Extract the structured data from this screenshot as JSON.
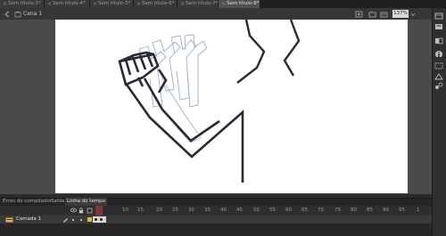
{
  "document_tabs": [
    {
      "label": "Sem título-3*",
      "active": false
    },
    {
      "label": "Sem título-4*",
      "active": false
    },
    {
      "label": "Sem título-5*",
      "active": false
    },
    {
      "label": "Sem título-6*",
      "active": false
    },
    {
      "label": "Sem título-7*",
      "active": false
    },
    {
      "label": "Sem título-8*",
      "active": true
    }
  ],
  "edit_bar": {
    "scene": "Cena 1",
    "zoom": "137%"
  },
  "panel_tabs": [
    "Erros do compilador",
    "Saída",
    "Linha do tempo"
  ],
  "timeline": {
    "frame_numbers": [
      "10",
      "15",
      "20",
      "25",
      "30",
      "35",
      "40",
      "45",
      "50",
      "55",
      "60",
      "65",
      "70",
      "75",
      "80",
      "85",
      "90",
      "95",
      "1"
    ],
    "layer_name": "Camada 1",
    "current_frame": 5
  },
  "colors": {
    "stroke": "#2a2a35",
    "onion": "#9fb0c0",
    "accent": "#d84a55",
    "layer_icon": "#e2b64a"
  },
  "icons": [
    "close-icon",
    "scene-icon",
    "back-arrow-icon",
    "edit-symbol-icon",
    "center-stage-icon",
    "eye-icon",
    "lock-icon",
    "outline-icon",
    "pencil-icon",
    "layer-icon",
    "properties-icon",
    "library-icon",
    "info-icon",
    "align-icon",
    "transform-icon",
    "motion-presets-icon"
  ]
}
